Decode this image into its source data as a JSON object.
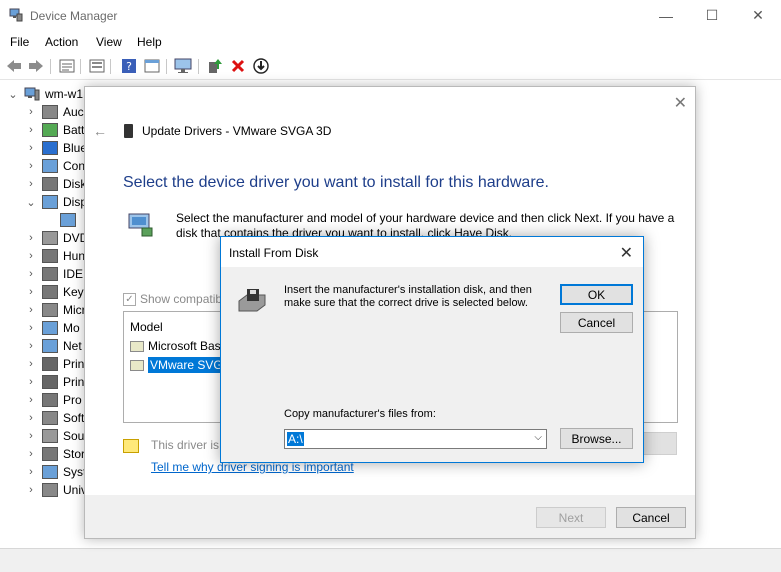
{
  "window": {
    "title": "Device Manager",
    "minimize": "—",
    "maximize": "☐",
    "close": "✕"
  },
  "menu": [
    "File",
    "Action",
    "View",
    "Help"
  ],
  "tree": {
    "root": "wm-w1",
    "items": [
      {
        "label": "Auc",
        "expanded": false
      },
      {
        "label": "Batt",
        "expanded": false
      },
      {
        "label": "Blue",
        "expanded": false
      },
      {
        "label": "Con",
        "expanded": false
      },
      {
        "label": "Disk",
        "expanded": false
      },
      {
        "label": "Disp",
        "expanded": true
      },
      {
        "label": "",
        "expanded": false,
        "child": true
      },
      {
        "label": "DVD",
        "expanded": false
      },
      {
        "label": "Hun",
        "expanded": false
      },
      {
        "label": "IDE",
        "expanded": false
      },
      {
        "label": "Key",
        "expanded": false
      },
      {
        "label": "Micr",
        "expanded": false
      },
      {
        "label": "Mo",
        "expanded": false
      },
      {
        "label": "Net",
        "expanded": false
      },
      {
        "label": "Prin",
        "expanded": false
      },
      {
        "label": "Prin",
        "expanded": false
      },
      {
        "label": "Pro",
        "expanded": false
      },
      {
        "label": "Soft",
        "expanded": false
      },
      {
        "label": "Sou",
        "expanded": false
      },
      {
        "label": "Stor",
        "expanded": false
      },
      {
        "label": "Syst",
        "expanded": false
      },
      {
        "label": "Univ",
        "expanded": false
      }
    ]
  },
  "wizard": {
    "title": "Update Drivers - VMware SVGA 3D",
    "heading": "Select the device driver you want to install for this hardware.",
    "instructions": "Select the manufacturer and model of your hardware device and then click Next. If you have a disk that contains the driver you want to install, click Have Disk.",
    "show_compatible": "Show compatib",
    "model_header": "Model",
    "models": [
      "Microsoft Basi",
      "VMware SVGA"
    ],
    "selected_model_index": 1,
    "signing_text": "This driver is",
    "signing_link": "Tell me why driver signing is important",
    "next_label": "Next",
    "cancel_label": "Cancel"
  },
  "install_from_disk": {
    "title": "Install From Disk",
    "message": "Insert the manufacturer's installation disk, and then make sure that the correct drive is selected below.",
    "ok_label": "OK",
    "cancel_label": "Cancel",
    "copy_label": "Copy manufacturer's files from:",
    "path_value": "A:\\",
    "browse_label": "Browse..."
  },
  "colors": {
    "accent": "#0078d7",
    "heading": "#1e3e8a",
    "link": "#0066cc"
  }
}
